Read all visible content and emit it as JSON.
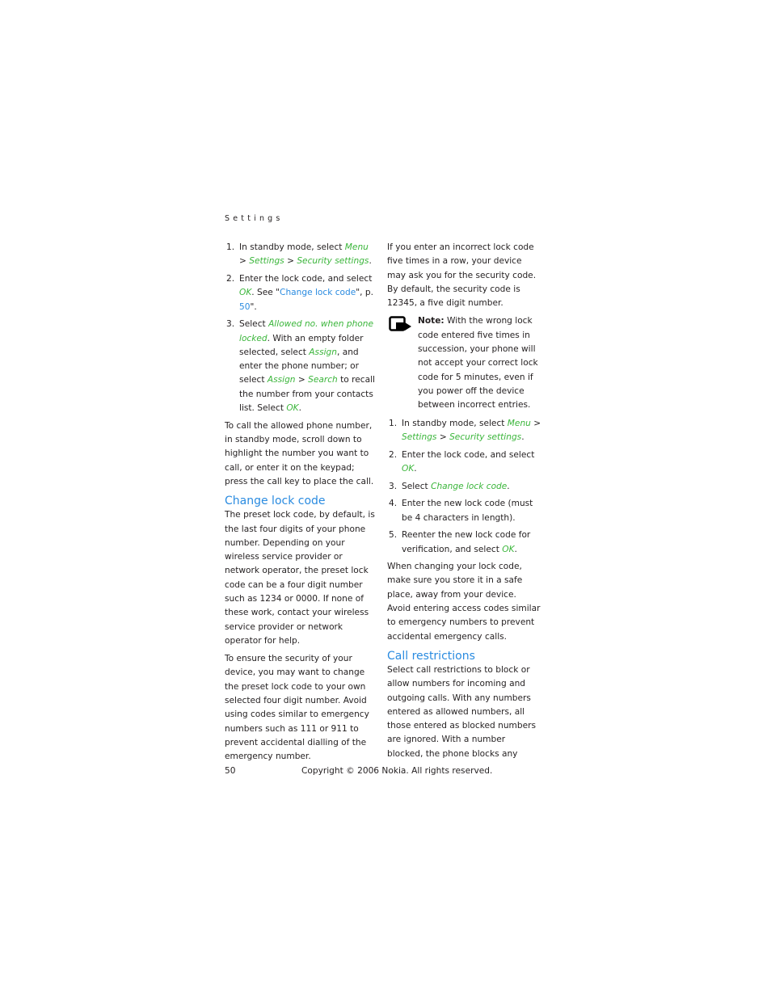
{
  "header": {
    "running_head": "Settings"
  },
  "left": {
    "steps": [
      {
        "num": "1.",
        "parts": [
          {
            "t": "In standby mode, select "
          },
          {
            "t": "Menu",
            "s": "g"
          },
          {
            "t": " > "
          },
          {
            "t": "Settings",
            "s": "g"
          },
          {
            "t": " > "
          },
          {
            "t": "Security settings",
            "s": "g"
          },
          {
            "t": "."
          }
        ]
      },
      {
        "num": "2.",
        "parts": [
          {
            "t": "Enter the lock code, and select "
          },
          {
            "t": "OK",
            "s": "g"
          },
          {
            "t": ". See \""
          },
          {
            "t": "Change lock code",
            "s": "b"
          },
          {
            "t": "\", p. "
          },
          {
            "t": "50",
            "s": "b"
          },
          {
            "t": "\"."
          }
        ]
      },
      {
        "num": "3.",
        "parts": [
          {
            "t": "Select "
          },
          {
            "t": "Allowed no. when phone locked",
            "s": "g"
          },
          {
            "t": ". With an empty folder selected, select "
          },
          {
            "t": "Assign",
            "s": "g"
          },
          {
            "t": ", and enter the phone number; or select "
          },
          {
            "t": "Assign",
            "s": "g"
          },
          {
            "t": " > "
          },
          {
            "t": "Search",
            "s": "g"
          },
          {
            "t": " to recall the number from your contacts list. Select "
          },
          {
            "t": "OK",
            "s": "g"
          },
          {
            "t": "."
          }
        ]
      }
    ],
    "para_call": "To call the allowed phone number, in standby mode, scroll down to highlight the number you want to call, or enter it on the keypad; press the call key to place the call.",
    "heading_change": "Change lock code",
    "para_preset": "The preset lock code, by default, is the last four digits of your phone number. Depending on your wireless service provider or network operator, the preset lock code can be a four digit number such as 1234 or 0000. If none of these work, contact your wireless service provider or network operator for help.",
    "para_ensure": "To ensure the security of your device, you may want to change the preset lock code to your own selected four digit number. Avoid using codes similar to emergency numbers such as 111 or 911 to prevent accidental dialling of the emergency number."
  },
  "right": {
    "para_incorrect": "If you enter an incorrect lock code five times in a row, your device may ask you for the security code. By default, the security code is 12345, a five digit number.",
    "note_label": "Note:",
    "note_text": " With the wrong lock code entered five times in succession, your phone will not accept your correct lock code for 5 minutes, even if you power off the device between incorrect entries.",
    "note_icon": "note-hand-icon",
    "steps": [
      {
        "num": "1.",
        "parts": [
          {
            "t": "In standby mode, select "
          },
          {
            "t": "Menu",
            "s": "g"
          },
          {
            "t": " > "
          },
          {
            "t": "Settings",
            "s": "g"
          },
          {
            "t": " > "
          },
          {
            "t": "Security settings",
            "s": "g"
          },
          {
            "t": "."
          }
        ]
      },
      {
        "num": "2.",
        "parts": [
          {
            "t": "Enter the lock code, and select "
          },
          {
            "t": "OK",
            "s": "g"
          },
          {
            "t": "."
          }
        ]
      },
      {
        "num": "3.",
        "parts": [
          {
            "t": "Select "
          },
          {
            "t": "Change lock code",
            "s": "g"
          },
          {
            "t": "."
          }
        ]
      },
      {
        "num": "4.",
        "parts": [
          {
            "t": "Enter the new lock code (must be 4 characters in length)."
          }
        ]
      },
      {
        "num": "5.",
        "parts": [
          {
            "t": "Reenter the new lock code for verification, and select "
          },
          {
            "t": "OK",
            "s": "g"
          },
          {
            "t": "."
          }
        ]
      }
    ],
    "para_changing": "When changing your lock code, make sure you store it in a safe place, away from your device. Avoid entering access codes similar to emergency numbers to prevent accidental emergency calls.",
    "heading_restrictions": "Call restrictions",
    "para_restrictions": "Select call restrictions to block or allow numbers for incoming and outgoing calls. With any numbers entered as allowed numbers, all those entered as blocked numbers are ignored. With a number blocked, the phone blocks any"
  },
  "footer": {
    "page_number": "50",
    "copyright": "Copyright © 2006 Nokia. All rights reserved."
  },
  "colors": {
    "menu_term": "#3ab53a",
    "link": "#2a8be0",
    "text": "#231f20"
  }
}
